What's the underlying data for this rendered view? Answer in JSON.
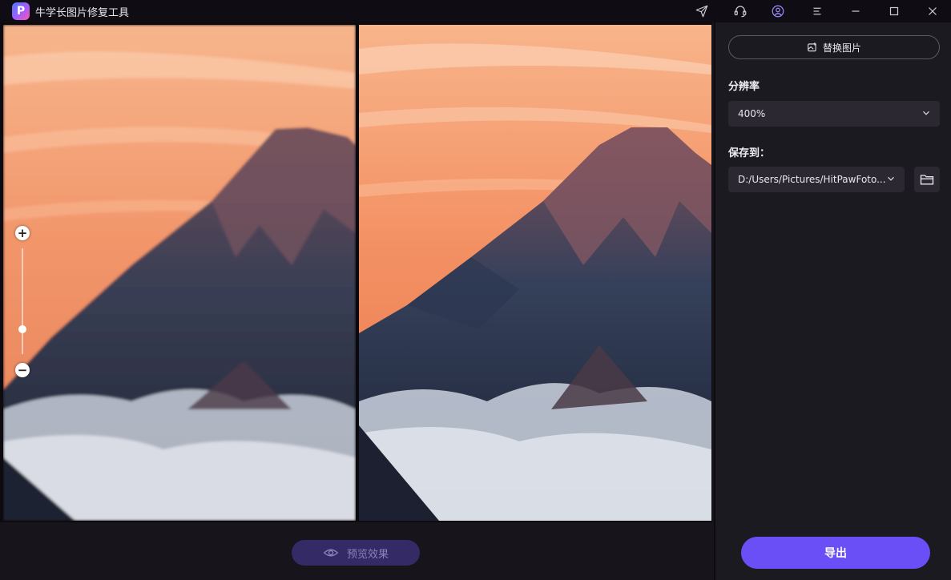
{
  "app": {
    "title": "牛学长图片修复工具",
    "logo_letter": "P"
  },
  "titlebar": {
    "icons": [
      "send-icon",
      "headset-icon",
      "user-icon",
      "menu-icon",
      "minimize-icon",
      "maximize-icon",
      "close-icon"
    ]
  },
  "zoom": {
    "plus": "+",
    "minus": "−",
    "level": 0.25
  },
  "preview": {
    "button_label": "预览效果"
  },
  "sidebar": {
    "replace_label": "替换图片",
    "resolution_label": "分辨率",
    "resolution_value": "400%",
    "save_label": "保存到：",
    "save_path": "D:/Users/Pictures/HitPawFoto...",
    "export_label": "导出"
  },
  "colors": {
    "accent": "#6b4ff6",
    "preview_button": "#332a66",
    "background": "#17141c",
    "sidebar": "#1c1a21"
  }
}
